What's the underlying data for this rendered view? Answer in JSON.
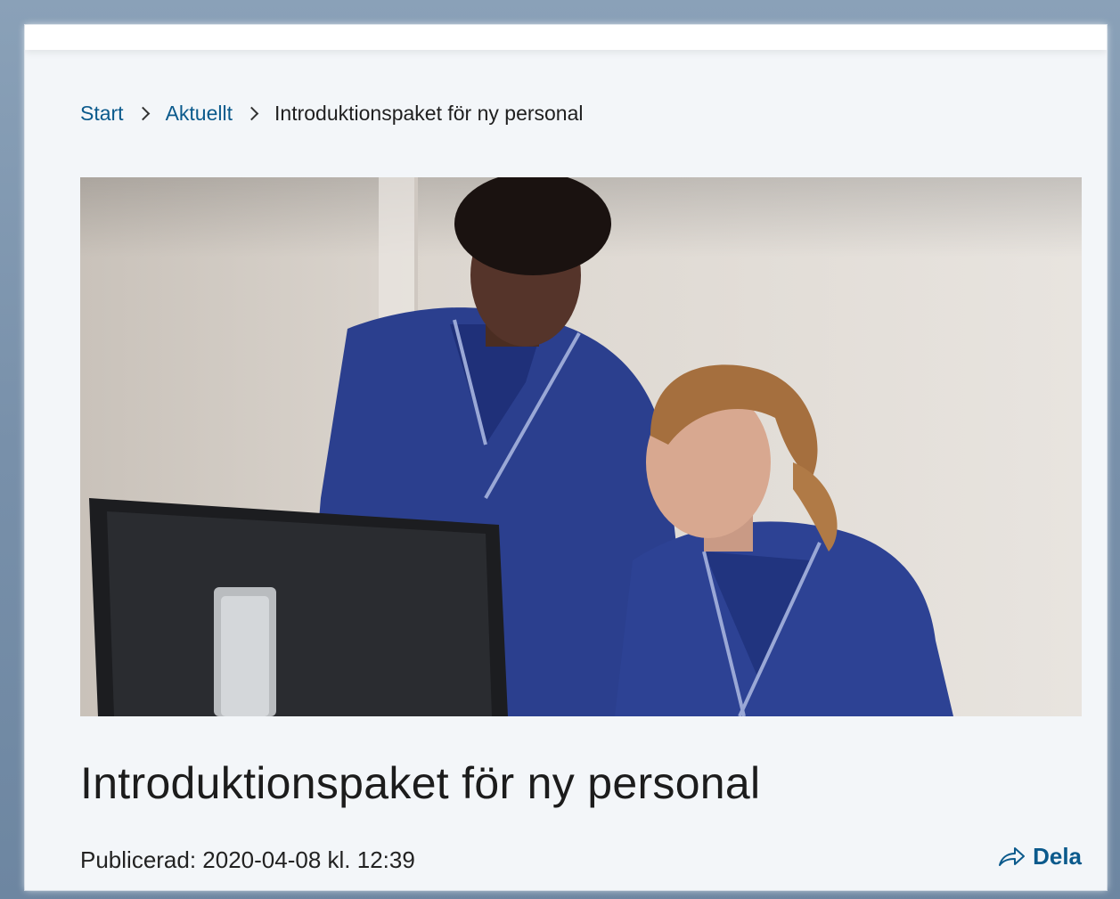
{
  "breadcrumb": {
    "items": [
      {
        "label": "Start"
      },
      {
        "label": "Aktuellt"
      }
    ],
    "current": "Introduktionspaket för ny personal"
  },
  "hero": {
    "alt": "Två sjuksköterskor i blå arbetskläder tittar på en datorskärm"
  },
  "article": {
    "title": "Introduktionspaket för ny personal",
    "published": "Publicerad: 2020-04-08 kl. 12:39"
  },
  "share": {
    "label": "Dela",
    "icon": "share-arrow-icon"
  },
  "colors": {
    "link": "#0b5a8c",
    "background": "#f3f6f9",
    "scrubs": "#2a3f8f"
  }
}
